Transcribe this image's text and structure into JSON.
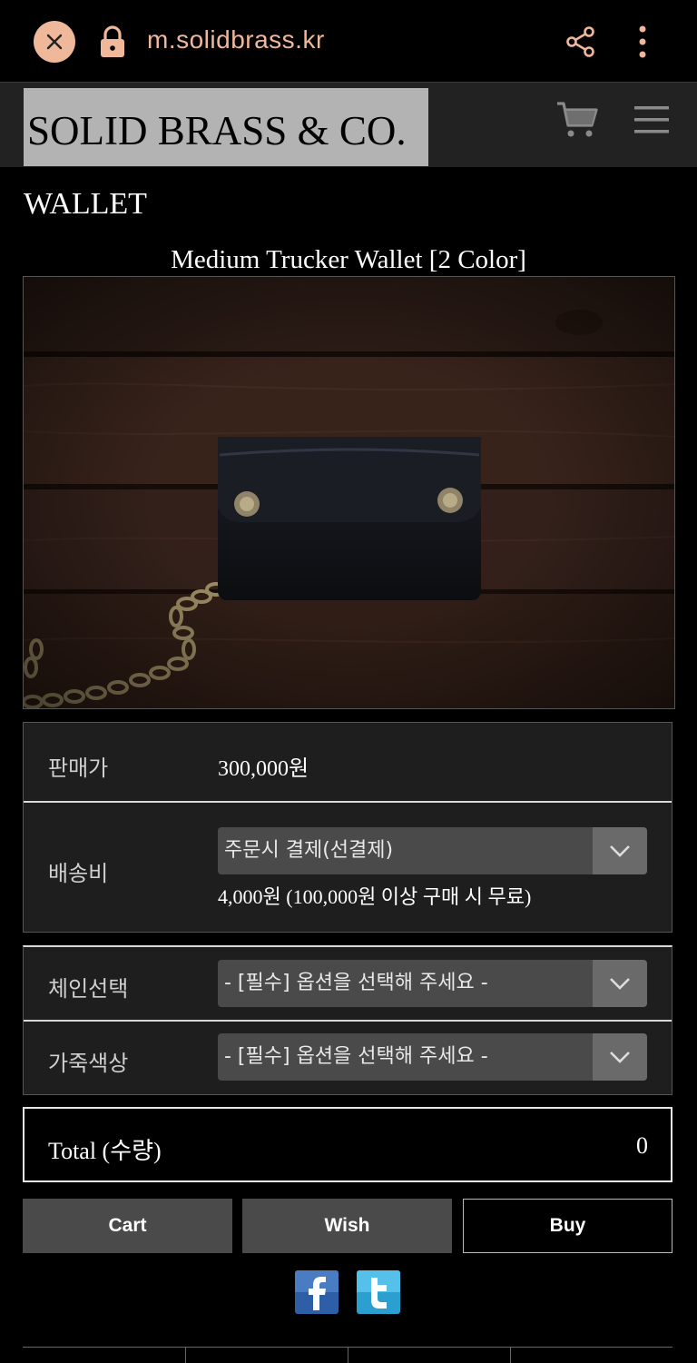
{
  "browser": {
    "url": "m.solidbrass.kr",
    "accent_color": "#f0b89a"
  },
  "site": {
    "logo_text": "SOLID BRASS & CO."
  },
  "category": "WALLET",
  "product": {
    "name": "Medium Trucker Wallet [2 Color]",
    "price_label": "판매가",
    "price_value": "300,000원",
    "shipping_label": "배송비",
    "shipping_select": "주문시 결제(선결제)",
    "shipping_note": "4,000원 (100,000원 이상 구매 시 무료)"
  },
  "options": [
    {
      "label": "체인선택",
      "placeholder": "- [필수] 옵션을 선택해 주세요 -"
    },
    {
      "label": "가죽색상",
      "placeholder": "- [필수] 옵션을 선택해 주세요 -"
    }
  ],
  "total": {
    "label": "Total (수량)",
    "value": "0"
  },
  "buttons": {
    "cart": "Cart",
    "wish": "Wish",
    "buy": "Buy"
  },
  "social": [
    "facebook-icon",
    "twitter-icon"
  ]
}
